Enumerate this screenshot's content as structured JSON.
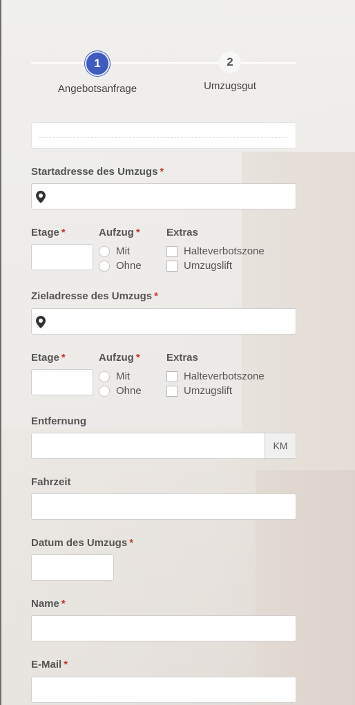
{
  "stepper": {
    "steps": [
      {
        "number": "1",
        "label": "Angebotsanfrage"
      },
      {
        "number": "2",
        "label": "Umzugsgut"
      }
    ]
  },
  "start": {
    "address_label": "Startadresse des Umzugs",
    "etage_label": "Etage",
    "aufzug_label": "Aufzug",
    "extras_label": "Extras",
    "aufzug_options": [
      "Mit",
      "Ohne"
    ],
    "extras_options": [
      "Halteverbotszone",
      "Umzugslift"
    ]
  },
  "ziel": {
    "address_label": "Zieladresse des Umzugs",
    "etage_label": "Etage",
    "aufzug_label": "Aufzug",
    "extras_label": "Extras",
    "aufzug_options": [
      "Mit",
      "Ohne"
    ],
    "extras_options": [
      "Halteverbotszone",
      "Umzugslift"
    ]
  },
  "entfernung": {
    "label": "Entfernung",
    "unit": "KM"
  },
  "fahrzeit": {
    "label": "Fahrzeit"
  },
  "datum": {
    "label": "Datum des Umzugs"
  },
  "name": {
    "label": "Name"
  },
  "email": {
    "label": "E-Mail"
  },
  "required_marker": "*",
  "colors": {
    "accent": "#3f5bbd",
    "required": "#c0392b"
  },
  "icons": {
    "address": "map-pin-icon"
  }
}
